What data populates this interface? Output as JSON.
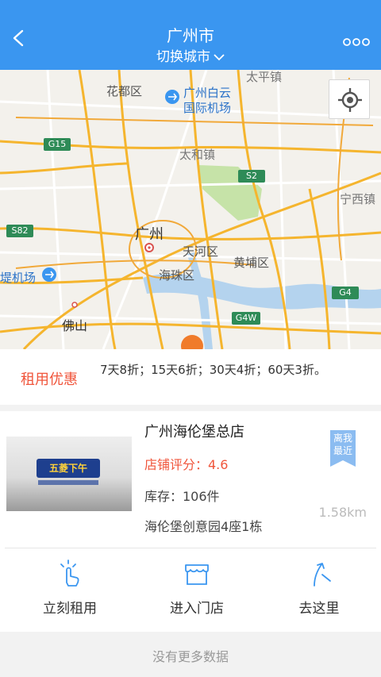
{
  "header": {
    "title": "广州市",
    "switch_city": "切换城市",
    "bg_color": "#3a96f0"
  },
  "map": {
    "labels": {
      "huadu": "花都区",
      "baiyun_airport_1": "广州白云",
      "baiyun_airport_2": "国际机场",
      "taiping": "太平镇",
      "taihe": "太和镇",
      "ningxi": "宁西镇",
      "guangzhou": "广州",
      "tianhe": "天河区",
      "huangpu": "黄埔区",
      "haizhu": "海珠区",
      "airport_left": "堤机场",
      "foshan": "佛山",
      "g15": "G15",
      "s2": "S2",
      "s82": "S82",
      "g4": "G4",
      "g4w": "G4W"
    }
  },
  "discount": {
    "label": "租用优惠",
    "text": "7天8折；15天6折；30天4折；60天3折。"
  },
  "store": {
    "name": "广州海伦堡总店",
    "rating": "店铺评分：4.6",
    "stock": "库存：106件",
    "address": "海伦堡创意园4座1栋",
    "nearest_badge": "离我最近",
    "distance": "1.58km",
    "sign_text": "五菱下午",
    "accent_color": "#f0553b"
  },
  "actions": {
    "rent": "立刻租用",
    "enter": "进入门店",
    "go": "去这里"
  },
  "footer": {
    "no_more": "没有更多数据"
  }
}
